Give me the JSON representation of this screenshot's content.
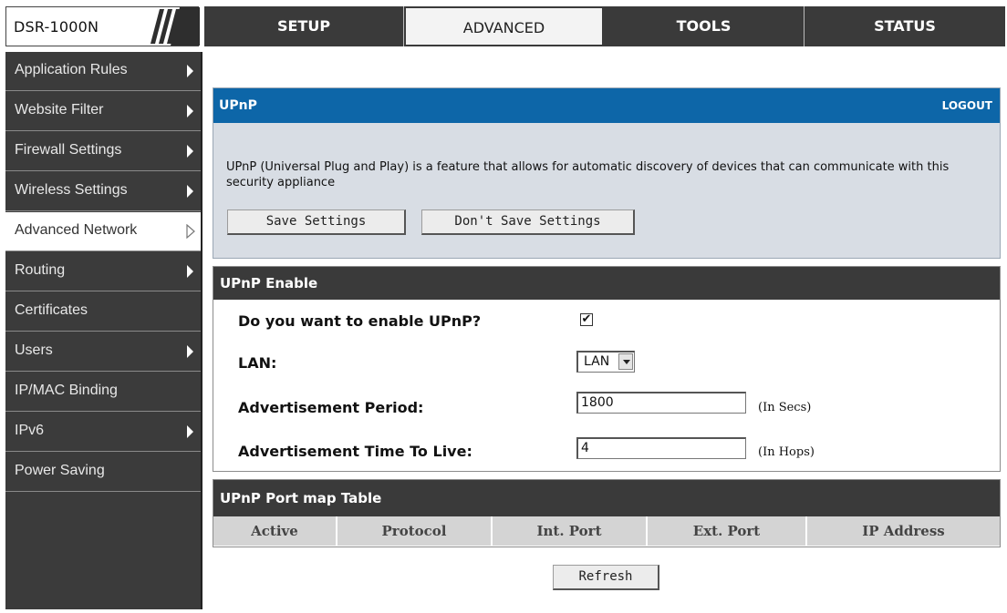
{
  "brand": {
    "model": "DSR-1000N"
  },
  "nav": {
    "tabs": [
      {
        "label": "SETUP",
        "active": false
      },
      {
        "label": "ADVANCED",
        "active": true
      },
      {
        "label": "TOOLS",
        "active": false
      },
      {
        "label": "STATUS",
        "active": false
      }
    ]
  },
  "sidebar": {
    "items": [
      {
        "label": "Application Rules",
        "has_submenu": true,
        "active": false
      },
      {
        "label": "Website Filter",
        "has_submenu": true,
        "active": false
      },
      {
        "label": "Firewall Settings",
        "has_submenu": true,
        "active": false
      },
      {
        "label": "Wireless Settings",
        "has_submenu": true,
        "active": false
      },
      {
        "label": "Advanced Network",
        "has_submenu": true,
        "active": true
      },
      {
        "label": "Routing",
        "has_submenu": true,
        "active": false
      },
      {
        "label": "Certificates",
        "has_submenu": false,
        "active": false
      },
      {
        "label": "Users",
        "has_submenu": true,
        "active": false
      },
      {
        "label": "IP/MAC Binding",
        "has_submenu": false,
        "active": false
      },
      {
        "label": "IPv6",
        "has_submenu": true,
        "active": false
      },
      {
        "label": "Power Saving",
        "has_submenu": false,
        "active": false
      }
    ]
  },
  "upnp": {
    "title": "UPnP",
    "logout": "LOGOUT",
    "description": "UPnP (Universal Plug and Play) is a feature that allows for automatic discovery of devices that can communicate with this security appliance",
    "save_label": "Save Settings",
    "dont_save_label": "Don't Save Settings"
  },
  "enable": {
    "title": "UPnP Enable",
    "enable_question": "Do you want to enable UPnP?",
    "enable_checked": true,
    "enable_mark": "✔",
    "lan_label": "LAN:",
    "lan_value": "LAN",
    "ad_period_label": "Advertisement Period:",
    "ad_period_value": "1800",
    "ad_period_unit": "(In Secs)",
    "ttl_label": "Advertisement Time To Live:",
    "ttl_value": "4",
    "ttl_unit": "(In Hops)"
  },
  "portmap": {
    "title": "UPnP Port map Table",
    "columns": [
      "Active",
      "Protocol",
      "Int. Port",
      "Ext. Port",
      "IP Address"
    ],
    "refresh_label": "Refresh"
  },
  "colors": {
    "header_blue": "#0d66a8",
    "dark_gray": "#3a3a3a",
    "panel_bg": "#d8dde4"
  }
}
